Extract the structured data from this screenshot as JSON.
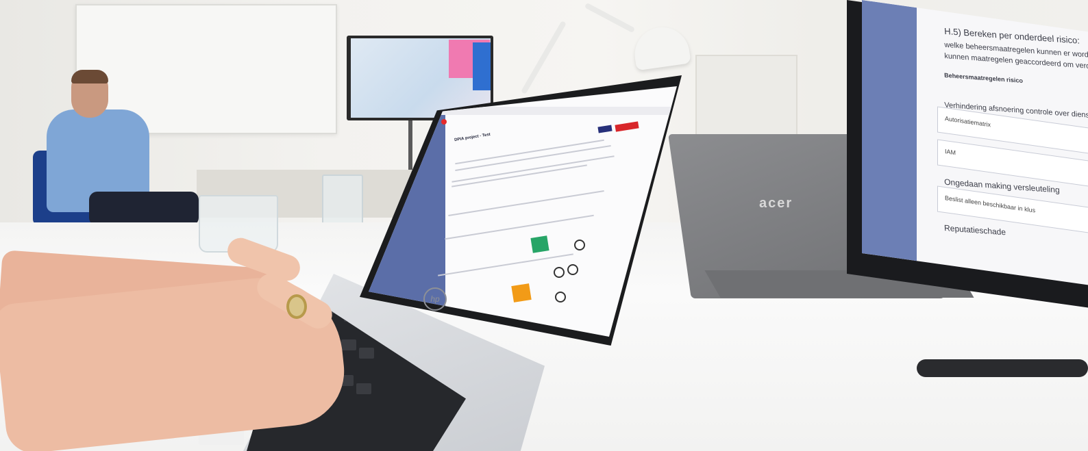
{
  "scene": {
    "description_items": [
      "laptop",
      "monitor",
      "acer-laptop",
      "person",
      "hands",
      "glass"
    ]
  },
  "acer_logo": "acer",
  "laptop_screen": {
    "title": "DPIA project - Test"
  },
  "monitor_screen": {
    "line1": "H.5) Bereken per onderdeel risico:",
    "line2": "welke beheersmaatregelen kunnen er worden getroffen? Welke",
    "line3": "kunnen maatregelen geaccordeerd om verder te implementeren?",
    "section_label": "Beheersmaatregelen risico",
    "line4": "Verhindering afsnoering controle over diens persoonsgegevens.",
    "field1": "Autorisatiematrix",
    "field2": "IAM",
    "line5": "Ongedaan making versleuteling",
    "field3": "Beslist alleen beschikbaar in klus",
    "line6": "Reputatieschade"
  },
  "colors": {
    "sidebar": "#5b6ea8",
    "green_cell": "#27a567",
    "orange_cell": "#f29b17",
    "danger": "#d8262a",
    "primary": "#27307a"
  }
}
